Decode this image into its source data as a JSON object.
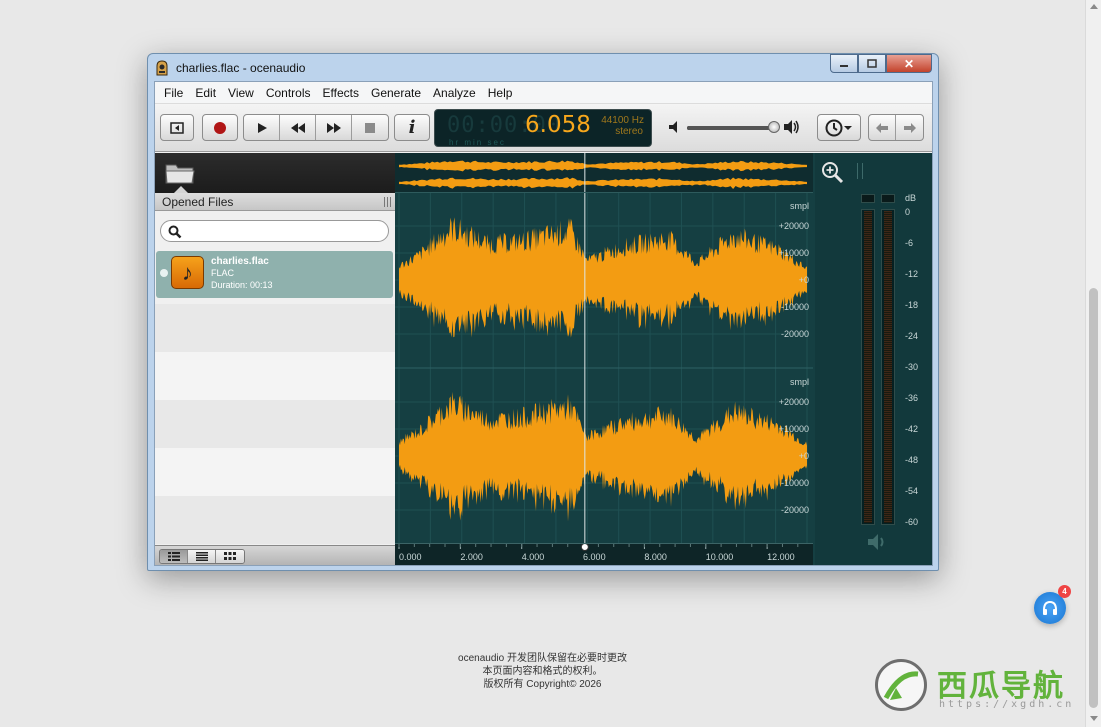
{
  "window": {
    "title": "charlies.flac - ocenaudio",
    "minimize_glyph": "–",
    "maximize_glyph": "□",
    "close_glyph": "✕"
  },
  "menu": [
    "File",
    "Edit",
    "View",
    "Controls",
    "Effects",
    "Generate",
    "Analyze",
    "Help"
  ],
  "toolbar": {
    "ghost_digits": "00:00:00",
    "time": "6.058",
    "sample_rate": "44100 Hz",
    "channels": "stereo",
    "time_units": "hr   min sec",
    "volume_level": 0.95,
    "info_label": "i"
  },
  "sidebar": {
    "title": "Opened Files",
    "search_placeholder": "",
    "files": [
      {
        "name": "charlies.flac",
        "type": "FLAC",
        "duration": "Duration: 00:13"
      }
    ]
  },
  "waveform": {
    "unit_label": "smpl",
    "y_ticks": [
      "+20000",
      "+10000",
      "+0",
      "-10000",
      "-20000"
    ],
    "x_ticks": [
      "0.000",
      "2.000",
      "4.000",
      "6.000",
      "8.000",
      "10.000",
      "12.000"
    ],
    "cursor_time": 6.058,
    "duration": 13.3,
    "wave_color": "#f39c12",
    "bg_color": "#153f42"
  },
  "meters": {
    "unit": "dB",
    "ticks": [
      "0",
      "-6",
      "-12",
      "-18",
      "-24",
      "-30",
      "-36",
      "-42",
      "-48",
      "-54",
      "-60"
    ]
  },
  "page_footer": {
    "line1": "ocenaudio 开发团队保留在必要时更改",
    "line2": "本页面内容和格式的权利。",
    "line3": "版权所有 Copyright© 2026"
  },
  "notification": {
    "badge": "4"
  },
  "watermark": {
    "brand": "西瓜导航",
    "url": "https://xgdh.cn"
  }
}
